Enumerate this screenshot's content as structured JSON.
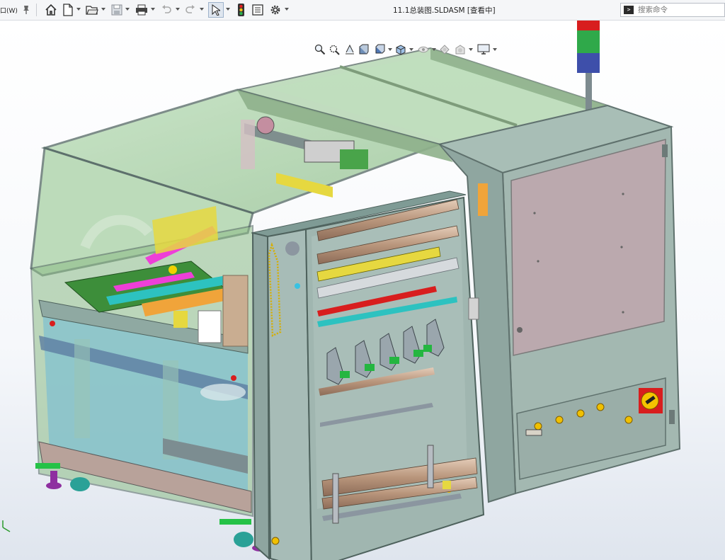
{
  "toolbar": {
    "menu_fragment": "口(W)",
    "document_title": "11.1总装图.SLDASM [查看中]",
    "icons": [
      "pin-icon",
      "home-icon",
      "new-document-icon",
      "open-folder-icon",
      "save-icon",
      "print-icon",
      "undo-icon",
      "redo-icon",
      "select-arrow-icon",
      "rebuild-traffic-light-icon",
      "file-properties-icon",
      "options-gear-icon"
    ]
  },
  "search": {
    "placeholder": "搜索命令",
    "icon": "command-prompt-icon"
  },
  "heads_up_toolbar": {
    "icons": [
      "zoom-to-fit-icon",
      "zoom-to-area-icon",
      "previous-view-icon",
      "section-view-icon",
      "view-orientation-icon",
      "display-style-icon",
      "hide-show-items-icon",
      "edit-appearance-icon",
      "apply-scene-icon",
      "view-settings-icon"
    ]
  },
  "model": {
    "name": "11.1总装图",
    "colors": {
      "frame_green": "#97c090",
      "glass_green": "#a9d3a6",
      "cabinet_gray": "#9fb3ab",
      "door_mauve": "#b9a7ab",
      "blue_inner": "#7dbfd2",
      "pink_part": "#ee3fd8",
      "yellow_part": "#e6d840",
      "roller_brown": "#c4a48c",
      "red_lamp": "#d81e1e",
      "green_lamp": "#2fa94a",
      "blue_lamp": "#3e4faa",
      "feet_purple": "#8e2fa0",
      "estop_yellow": "#f5c400"
    }
  }
}
